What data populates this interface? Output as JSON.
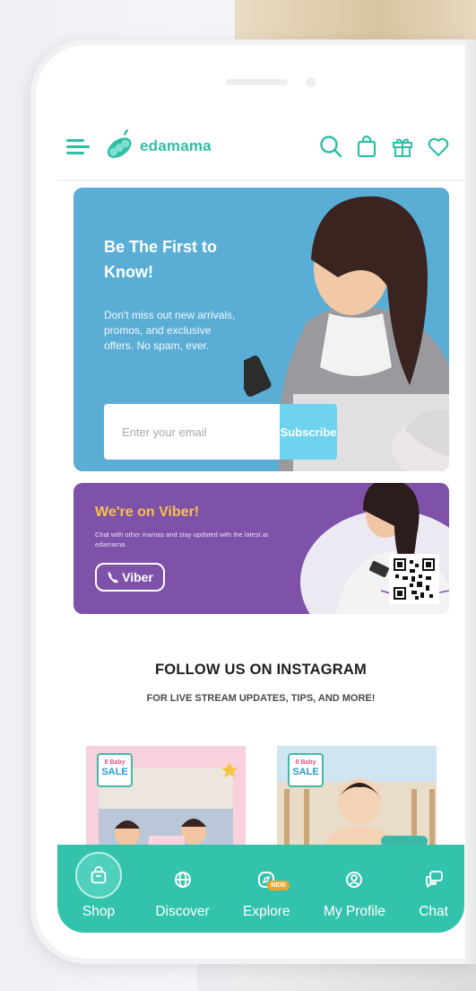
{
  "header": {
    "brand": "edamama",
    "icons": [
      "menu-icon",
      "search-icon",
      "bag-icon",
      "gift-icon",
      "heart-icon"
    ],
    "accent_color": "#2fbfa6"
  },
  "subscribe_banner": {
    "title": "Be The First to Know!",
    "description": "Don't miss out new arrivals, promos, and exclusive offers. No spam, ever.",
    "email_placeholder": "Enter your email",
    "button_label": "Subscribe",
    "background_color": "#5aaed6"
  },
  "viber_banner": {
    "title": "We're on Viber!",
    "description": "Chat with other mamas and stay updated with the latest at edamama.",
    "button_label": "Viber",
    "background_color": "#7e52a9"
  },
  "instagram": {
    "title": "FOLLOW US ON INSTAGRAM",
    "subtitle": "FOR LIVE STREAM UPDATES, TIPS, AND MORE!",
    "posts": [
      {
        "badge_top": "8 Baby",
        "badge_main": "SALE"
      },
      {
        "badge_top": "8 Baby",
        "badge_main": "SALE"
      }
    ]
  },
  "bottom_nav": {
    "items": [
      {
        "label": "Shop",
        "icon": "shopping-bag-icon",
        "active": true
      },
      {
        "label": "Discover",
        "icon": "globe-icon",
        "active": false
      },
      {
        "label": "Explore",
        "icon": "compass-icon",
        "active": false,
        "badge": "NEW"
      },
      {
        "label": "My Profile",
        "icon": "profile-icon",
        "active": false
      },
      {
        "label": "Chat",
        "icon": "chat-icon",
        "active": false
      }
    ],
    "background_color": "#33c2ac"
  }
}
